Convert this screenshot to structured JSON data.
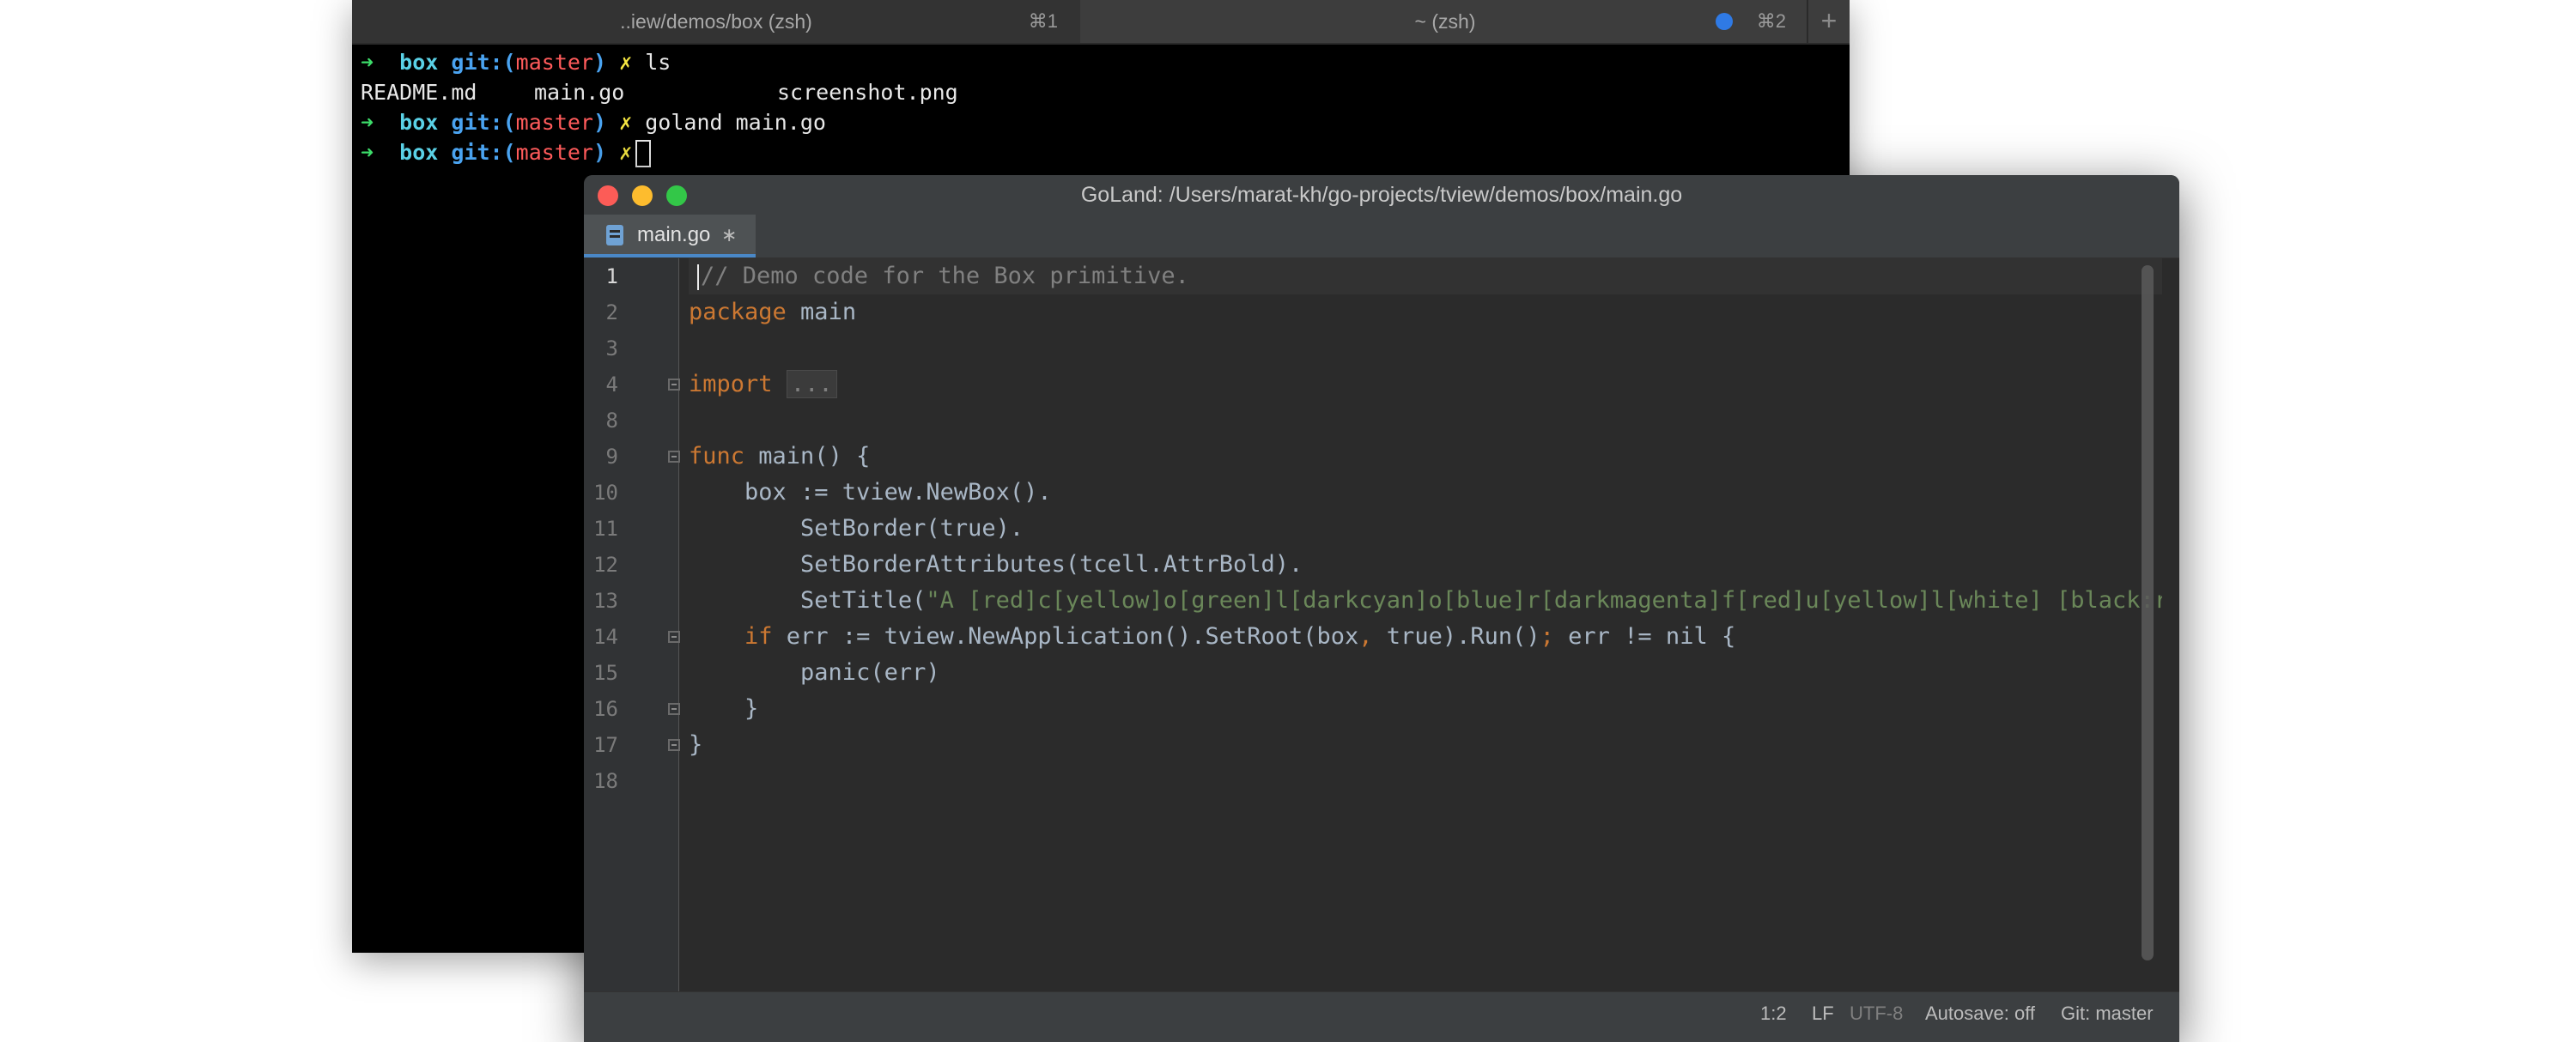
{
  "terminal": {
    "tabs": [
      {
        "label": "..iew/demos/box (zsh)",
        "shortcut": "⌘1"
      },
      {
        "label": "~ (zsh)",
        "shortcut": "⌘2"
      }
    ],
    "new_tab_label": "+",
    "prompt": {
      "arrow": "➜",
      "dir": "box",
      "git": "git:",
      "paren_open": "(",
      "branch": "master",
      "paren_close": ")",
      "dirty": "✗"
    },
    "lines": [
      {
        "command": "ls"
      },
      {
        "output": [
          "README.md",
          "main.go",
          "screenshot.png"
        ]
      },
      {
        "command": "goland main.go"
      },
      {
        "command": ""
      }
    ]
  },
  "goland": {
    "title": "GoLand: /Users/marat-kh/go-projects/tview/demos/box/main.go",
    "tab": {
      "filename": "main.go",
      "modified_marker": "∗"
    },
    "line_numbers": [
      "1",
      "2",
      "3",
      "4",
      "8",
      "9",
      "10",
      "11",
      "12",
      "13",
      "14",
      "15",
      "16",
      "17",
      "18"
    ],
    "code": {
      "l1_comment": "// Demo code for the Box primitive.",
      "l2_kw": "package",
      "l2_rest": " main",
      "l4_kw": "import",
      "l4_folded": "...",
      "l9_kw": "func",
      "l9_rest": " main() {",
      "l10": "    box := tview.NewBox().",
      "l11": "        SetBorder(true).",
      "l12": "        SetBorderAttributes(tcell.AttrBold).",
      "l13_pre": "        SetTitle(",
      "l13_str": "\"A [red]c[yellow]o[green]l[darkcyan]o[blue]r[darkmagenta]f[red]u[yellow]l[white] [black:red]c[:yellow]o[:green]l[:darkcyan]o[:blue]r[:darkmagenta]f[:red]u[:yellow]l\"",
      "l14_pre": "    ",
      "l14_kw": "if",
      "l14_a": " err := tview.NewApplication().SetRoot(box",
      "l14_comma": ",",
      "l14_b": " true).Run()",
      "l14_semi": ";",
      "l14_c": " err != nil {",
      "l15": "        panic(err)",
      "l16": "    }",
      "l17": "}"
    },
    "status": {
      "position": "1:2",
      "line_sep": "LF",
      "encoding": "UTF-8",
      "autosave": "Autosave: off",
      "git": "Git: master"
    }
  }
}
